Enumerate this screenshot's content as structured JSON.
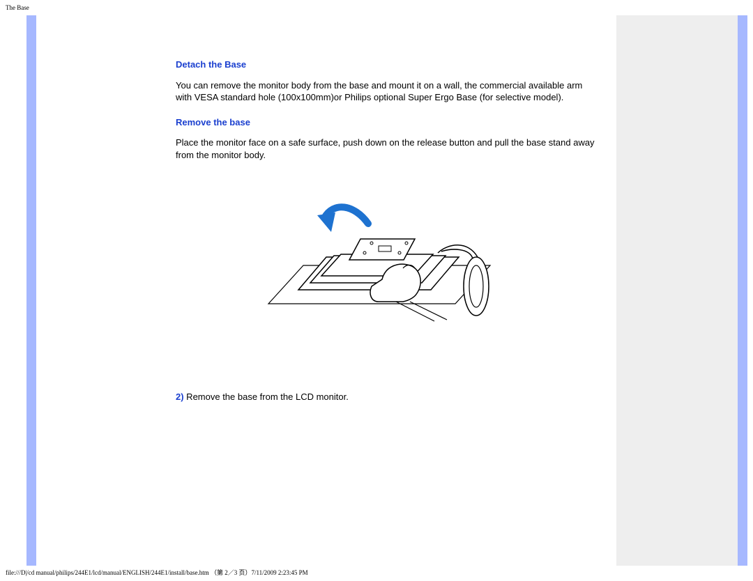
{
  "header": {
    "title": "The Base"
  },
  "content": {
    "heading1": "Detach the Base",
    "para1": "You can remove the monitor body from the base and mount it on a wall, the commercial available arm with VESA standard hole (100x100mm)or Philips optional Super Ergo Base (for selective model).",
    "heading2": "Remove the base",
    "para2": "Place the monitor face on a safe surface, push down on the release button and pull the base stand away from the monitor body.",
    "step2_num": "2)",
    "step2_text": " Remove  the base from the LCD monitor."
  },
  "footer": {
    "text": "file:///D|/cd manual/philips/244E1/lcd/manual/ENGLISH/244E1/install/base.htm （第 2／3 页）7/11/2009 2:23:45 PM"
  }
}
